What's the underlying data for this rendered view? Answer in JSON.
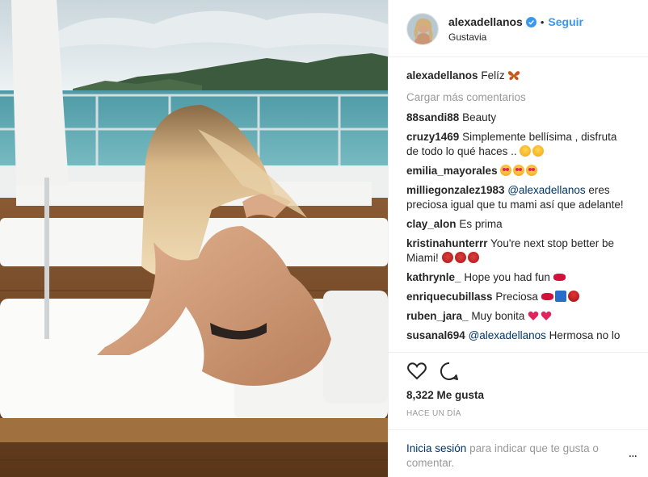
{
  "post": {
    "photo_alt": "",
    "colors": {
      "link": "#3897f0",
      "mention": "#003569",
      "muted": "#999999",
      "verified": "#3897f0"
    }
  },
  "header": {
    "username": "alexadellanos",
    "dot": "•",
    "follow_label": "Seguir",
    "location": "Gustavia"
  },
  "caption": {
    "username": "alexadellanos",
    "text": "Felíz"
  },
  "load_more": "Cargar más comentarios",
  "comments": [
    {
      "username": "88sandi88",
      "text": "Beauty"
    },
    {
      "username": "cruzy1469",
      "text": "Simplemente bellísima , disfruta de todo lo qué haces .."
    },
    {
      "username": "emilia_mayorales",
      "text": ""
    },
    {
      "username": "milliegonzalez1983",
      "mention": "@alexadellanos",
      "text": "eres preciosa igual que tu mami así que adelante!"
    },
    {
      "username": "clay_alon",
      "text": "Es prima"
    },
    {
      "username": "kristinahunterrr",
      "text": "You're next stop better be Miami!"
    },
    {
      "username": "kathrynle_",
      "text": "Hope you had fun"
    },
    {
      "username": "enriquecubillass",
      "text": "Preciosa"
    },
    {
      "username": "ruben_jara_",
      "text": "Muy bonita"
    },
    {
      "username": "susanal694",
      "mention": "@alexadellanos",
      "text": "Hermosa no lo"
    }
  ],
  "actions": {
    "like_icon": "heart-outline-icon",
    "comment_icon": "comment-bubble-icon"
  },
  "likes": "8,322 Me gusta",
  "timestamp": "Hace un día",
  "login": {
    "link": "Inicia sesión",
    "text": "para indicar que te gusta o comentar."
  },
  "more_options": "..."
}
